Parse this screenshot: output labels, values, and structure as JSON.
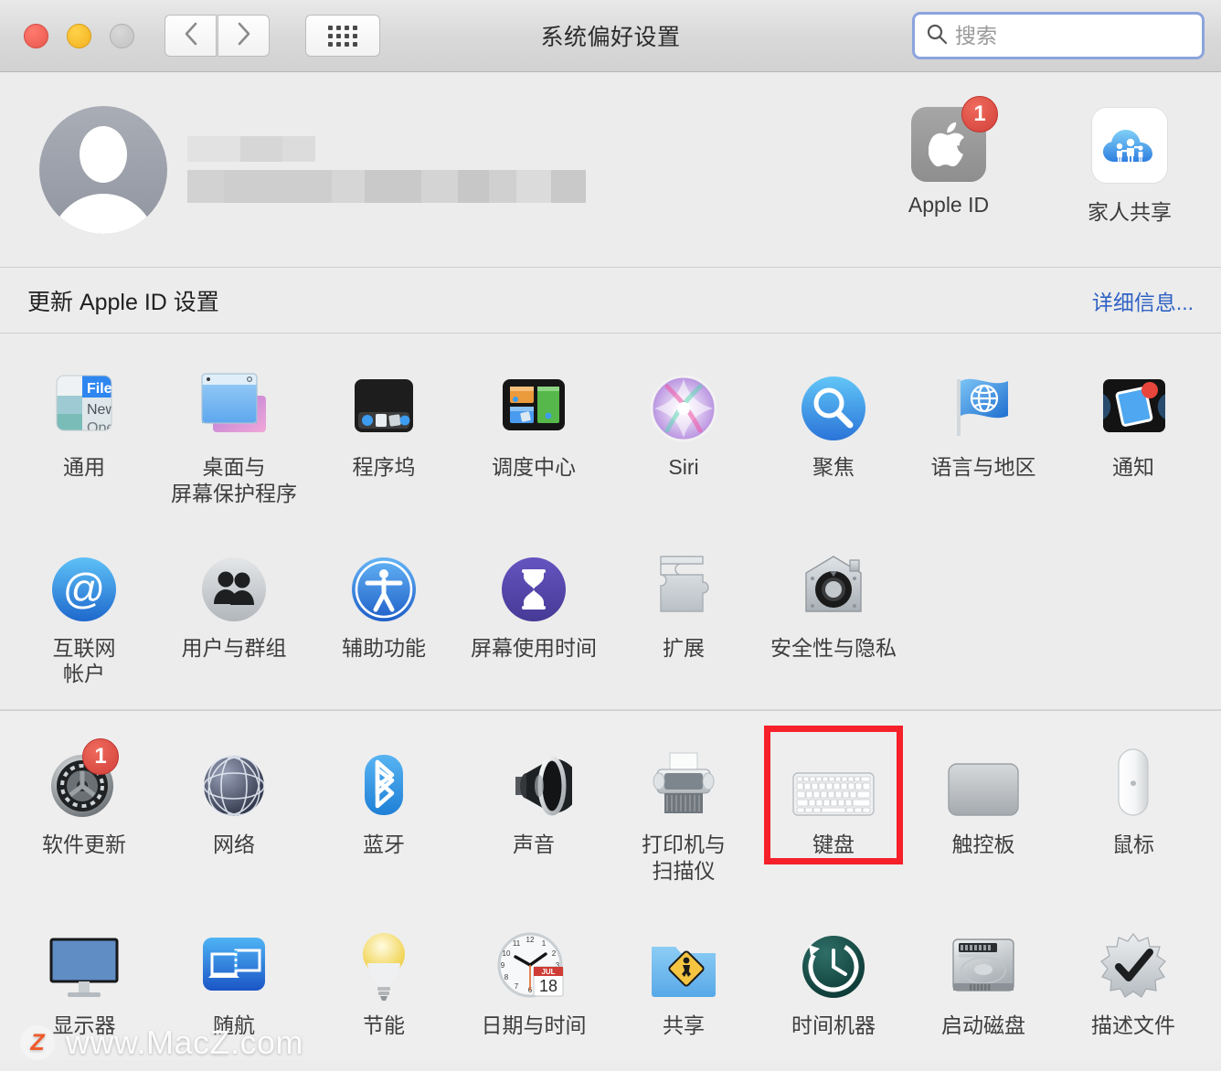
{
  "window": {
    "title": "系统偏好设置",
    "traffic_lights": [
      "close",
      "minimize",
      "zoom"
    ],
    "nav": {
      "back_icon": "chevron-left-icon",
      "forward_icon": "chevron-right-icon",
      "grid_icon": "grid-dots-icon"
    },
    "search": {
      "placeholder": "搜索",
      "value": "",
      "icon": "search-icon",
      "focused": true
    }
  },
  "account": {
    "avatar_icon": "default-user-avatar",
    "name_redacted": true,
    "email_redacted": true,
    "shortcuts": [
      {
        "label": "Apple ID",
        "icon": "apple-logo-icon",
        "badge": "1"
      },
      {
        "label": "家人共享",
        "icon": "family-sharing-cloud-icon",
        "badge": ""
      }
    ]
  },
  "banner": {
    "text": "更新 Apple ID 设置",
    "link": "详细信息..."
  },
  "sections": [
    {
      "name": "personal",
      "rows": [
        [
          {
            "label": "通用",
            "icon": "general-menu-icon"
          },
          {
            "label": "桌面与\n屏幕保护程序",
            "icon": "desktop-screensaver-icon"
          },
          {
            "label": "程序坞",
            "icon": "dock-icon"
          },
          {
            "label": "调度中心",
            "icon": "mission-control-icon"
          },
          {
            "label": "Siri",
            "icon": "siri-icon"
          },
          {
            "label": "聚焦",
            "icon": "spotlight-magnifier-icon"
          },
          {
            "label": "语言与地区",
            "icon": "language-region-flag-icon"
          },
          {
            "label": "通知",
            "icon": "notifications-icon"
          }
        ],
        [
          {
            "label": "互联网\n帐户",
            "icon": "internet-accounts-at-icon"
          },
          {
            "label": "用户与群组",
            "icon": "users-groups-icon"
          },
          {
            "label": "辅助功能",
            "icon": "accessibility-icon"
          },
          {
            "label": "屏幕使用时间",
            "icon": "screen-time-hourglass-icon"
          },
          {
            "label": "扩展",
            "icon": "extensions-puzzle-icon"
          },
          {
            "label": "安全性与隐私",
            "icon": "security-privacy-house-icon"
          }
        ]
      ]
    },
    {
      "name": "hardware",
      "rows": [
        [
          {
            "label": "软件更新",
            "icon": "software-update-gear-icon",
            "badge": "1"
          },
          {
            "label": "网络",
            "icon": "network-globe-icon"
          },
          {
            "label": "蓝牙",
            "icon": "bluetooth-icon"
          },
          {
            "label": "声音",
            "icon": "sound-speaker-icon"
          },
          {
            "label": "打印机与\n扫描仪",
            "icon": "printers-scanners-icon"
          },
          {
            "label": "键盘",
            "icon": "keyboard-icon",
            "selected": true
          },
          {
            "label": "触控板",
            "icon": "trackpad-icon"
          },
          {
            "label": "鼠标",
            "icon": "mouse-icon"
          }
        ],
        [
          {
            "label": "显示器",
            "icon": "displays-monitor-icon"
          },
          {
            "label": "随航",
            "icon": "sidecar-icon"
          },
          {
            "label": "节能",
            "icon": "energy-saver-bulb-icon"
          },
          {
            "label": "日期与时间",
            "icon": "date-time-clock-icon",
            "month": "JUL",
            "day": "18"
          },
          {
            "label": "共享",
            "icon": "sharing-folder-icon"
          },
          {
            "label": "时间机器",
            "icon": "time-machine-icon"
          },
          {
            "label": "启动磁盘",
            "icon": "startup-disk-icon"
          },
          {
            "label": "描述文件",
            "icon": "profiles-checkmark-icon"
          }
        ]
      ]
    }
  ],
  "watermark": {
    "badge": "Z",
    "text": "www.MacZ.com"
  },
  "colors": {
    "accent_blue": "#2f62c4",
    "selection_red": "#f5202a",
    "badge_red": "#d2403a",
    "window_bg": "#ececec",
    "focus_ring": "#8ca4dd"
  }
}
